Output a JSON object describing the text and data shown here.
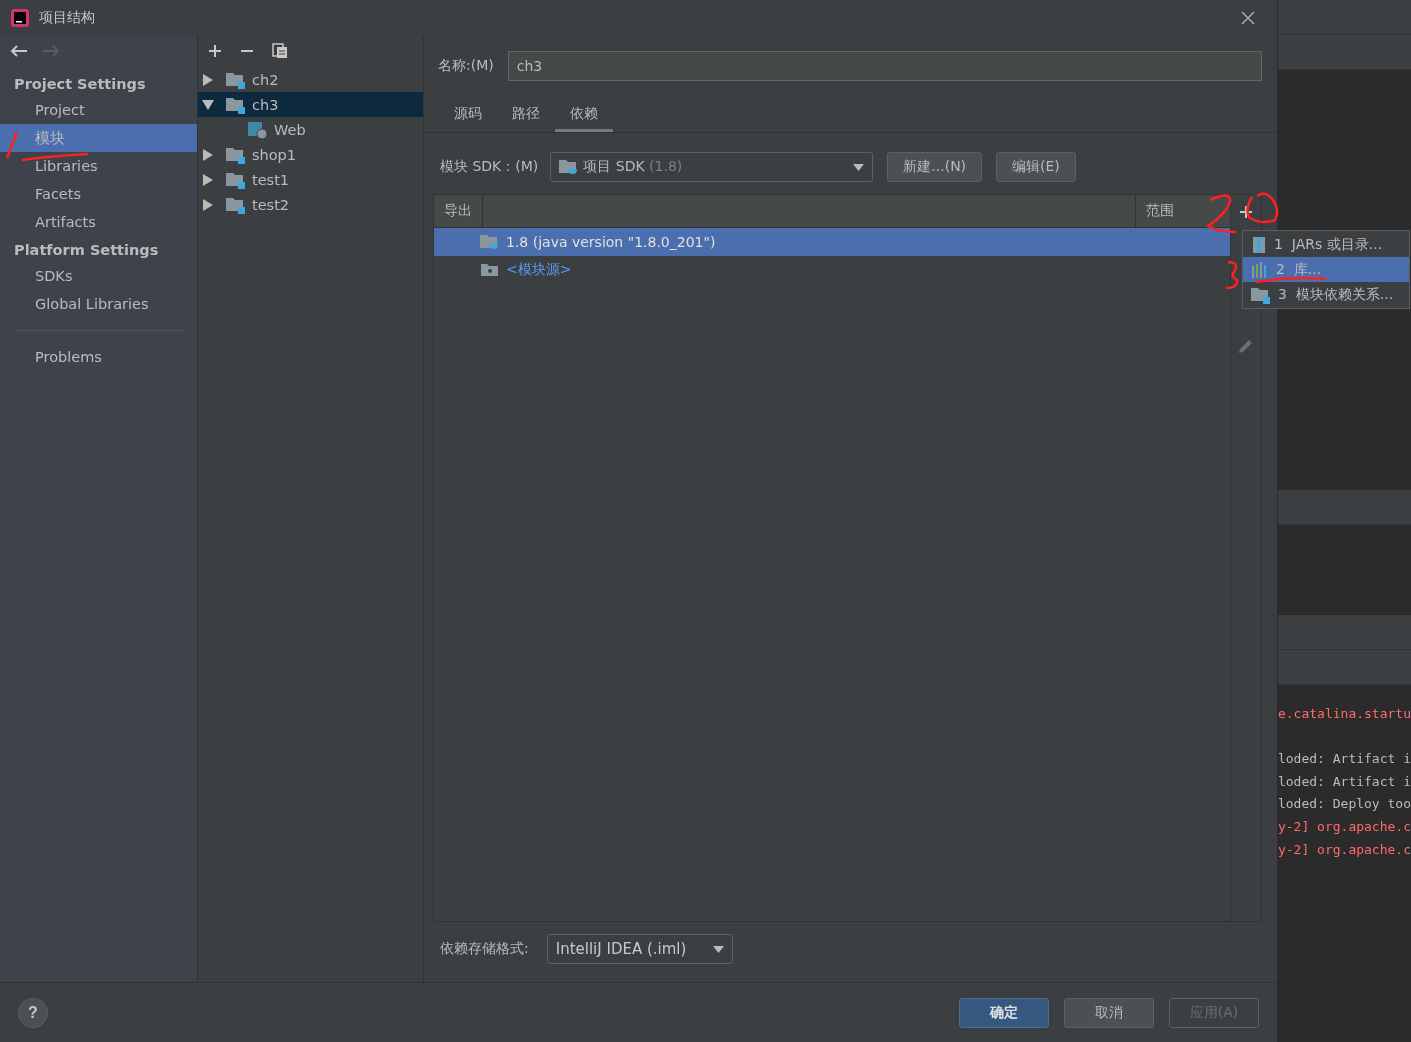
{
  "window": {
    "title": "项目结构"
  },
  "nav_buttons": [
    {
      "kind": "back",
      "disabled": false
    },
    {
      "kind": "forward",
      "disabled": true
    }
  ],
  "sidebar": {
    "sections": [
      {
        "heading": "Project Settings",
        "items": [
          {
            "label": "Project",
            "selected": false
          },
          {
            "label": "模块",
            "selected": true
          },
          {
            "label": "Libraries",
            "selected": false
          },
          {
            "label": "Facets",
            "selected": false
          },
          {
            "label": "Artifacts",
            "selected": false
          }
        ]
      },
      {
        "heading": "Platform Settings",
        "items": [
          {
            "label": "SDKs",
            "selected": false
          },
          {
            "label": "Global Libraries",
            "selected": false
          }
        ]
      }
    ],
    "extra_items": [
      {
        "label": "Problems",
        "selected": false
      }
    ]
  },
  "module_tree": [
    {
      "label": "ch2",
      "kind": "module",
      "expanded": false,
      "selected": false
    },
    {
      "label": "ch3",
      "kind": "module",
      "expanded": true,
      "selected": true,
      "children": [
        {
          "label": "Web",
          "kind": "web",
          "selected": false
        }
      ]
    },
    {
      "label": "shop1",
      "kind": "module",
      "expanded": false,
      "selected": false
    },
    {
      "label": "test1",
      "kind": "module",
      "expanded": false,
      "selected": false
    },
    {
      "label": "test2",
      "kind": "module",
      "expanded": false,
      "selected": false
    }
  ],
  "name_field": {
    "label": "名称:(M)",
    "value": "ch3"
  },
  "tabs": [
    {
      "label": "源码",
      "selected": false
    },
    {
      "label": "路径",
      "selected": false
    },
    {
      "label": "依赖",
      "selected": true
    }
  ],
  "sdk": {
    "label": "模块 SDK：(M)",
    "value": "项目 SDK",
    "hint": "(1.8)"
  },
  "sdk_buttons": [
    "新建...(N)",
    "编辑(E)"
  ],
  "dependencies": {
    "columns": [
      "导出",
      "范围"
    ],
    "rows": [
      {
        "label": "1.8 (java version \"1.8.0_201\")",
        "kind": "sdk",
        "selected": true
      },
      {
        "label": "<模块源>",
        "kind": "source",
        "selected": false
      }
    ]
  },
  "popup_menu": [
    {
      "number": "1",
      "label": "JARs 或目录...",
      "kind": "jar",
      "selected": false
    },
    {
      "number": "2",
      "label": "库...",
      "kind": "library",
      "selected": true
    },
    {
      "number": "3",
      "label": "模块依赖关系...",
      "kind": "module",
      "selected": false
    }
  ],
  "storage_format": {
    "label": "依赖存储格式:",
    "value": "IntelliJ IDEA (.iml)"
  },
  "help_button": "?",
  "footer_buttons": [
    {
      "label": "确定",
      "kind": "primary",
      "disabled": false
    },
    {
      "label": "取消",
      "kind": "normal",
      "disabled": false
    },
    {
      "label": "应用(A)",
      "kind": "normal",
      "disabled": true
    }
  ],
  "background_log": [
    {
      "text": "e.catalina.startu",
      "kind": "error"
    },
    {
      "text": "loded: Artifact i",
      "kind": "info"
    },
    {
      "text": "loded: Artifact i",
      "kind": "info"
    },
    {
      "text": "loded: Deploy too",
      "kind": "info"
    },
    {
      "text": "y-2] org.apache.c",
      "kind": "error"
    },
    {
      "text": "y-2] org.apache.c",
      "kind": "error"
    }
  ]
}
